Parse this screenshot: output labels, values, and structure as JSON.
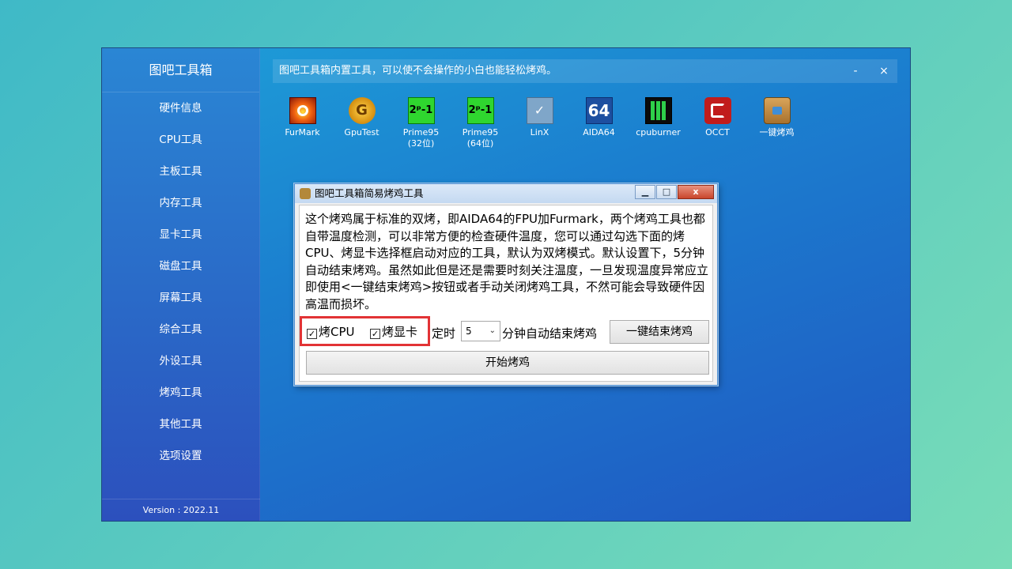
{
  "sidebar": {
    "title": "图吧工具箱",
    "items": [
      "硬件信息",
      "CPU工具",
      "主板工具",
      "内存工具",
      "显卡工具",
      "磁盘工具",
      "屏幕工具",
      "综合工具",
      "外设工具",
      "烤鸡工具",
      "其他工具",
      "选项设置"
    ],
    "version": "Version : 2022.11"
  },
  "topbar": {
    "text": "图吧工具箱内置工具，可以使不会操作的小白也能轻松烤鸡。",
    "minimize": "-",
    "close": "×"
  },
  "tools": [
    {
      "name": "FurMark",
      "icon": "furmark-icon"
    },
    {
      "name": "GpuTest",
      "icon": "gputest-icon"
    },
    {
      "name": "Prime95",
      "sub": "(32位)",
      "icon": "prime95-icon"
    },
    {
      "name": "Prime95",
      "sub": "(64位)",
      "icon": "prime95-icon"
    },
    {
      "name": "LinX",
      "icon": "linx-icon"
    },
    {
      "name": "AIDA64",
      "icon": "aida64-icon",
      "glyph": "64"
    },
    {
      "name": "cpuburner",
      "icon": "cpuburner-icon"
    },
    {
      "name": "OCCT",
      "icon": "occt-icon"
    },
    {
      "name": "一键烤鸡",
      "icon": "package-icon"
    }
  ],
  "dialog": {
    "title": "图吧工具箱简易烤鸡工具",
    "buttons": {
      "minimize": "▁",
      "maximize": "□",
      "close": "x"
    },
    "description": "这个烤鸡属于标准的双烤，即AIDA64的FPU加Furmark，两个烤鸡工具也都自带温度检测，可以非常方便的检查硬件温度，您可以通过勾选下面的烤CPU、烤显卡选择框启动对应的工具，默认为双烤模式。默认设置下，5分钟自动结束烤鸡。虽然如此但是还是需要时刻关注温度，一旦发现温度异常应立即使用<一键结束烤鸡>按钮或者手动关闭烤鸡工具，不然可能会导致硬件因高温而损坏。",
    "check_cpu": "烤CPU",
    "check_gpu": "烤显卡",
    "timer_label": "定时",
    "timer_value": "5",
    "timer_suffix": "分钟自动结束烤鸡",
    "stop_button": "一键结束烤鸡",
    "start_button": "开始烤鸡"
  },
  "colors": {
    "highlight": "#e23335"
  }
}
